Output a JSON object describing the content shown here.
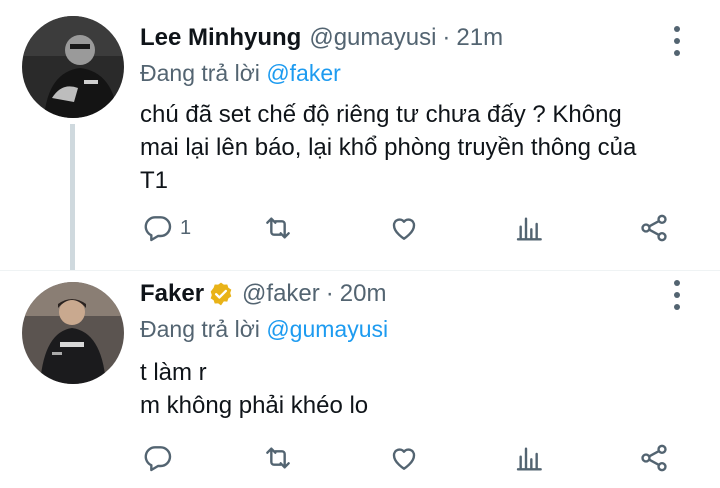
{
  "tweets": [
    {
      "name": "Lee Minhyung",
      "handle": "@gumayusi",
      "time": "21m",
      "reply_prefix": "Đang trả lời",
      "reply_mention": "@faker",
      "lines": [
        "chú đã set chế độ riêng tư chưa đấy ? Không",
        "mai lại lên báo, lại khổ phòng truyền thông của",
        "T1"
      ],
      "reply_count": "1",
      "verified": false
    },
    {
      "name": "Faker",
      "handle": "@faker",
      "time": "20m",
      "reply_prefix": "Đang trả lời",
      "reply_mention": "@gumayusi",
      "lines": [
        "t làm r",
        "m không phải khéo lo"
      ],
      "reply_count": "",
      "verified": true
    }
  ],
  "colors": {
    "accent": "#1d9bf0",
    "secondary_text": "#536471",
    "verified_badge": "#e9b318"
  }
}
